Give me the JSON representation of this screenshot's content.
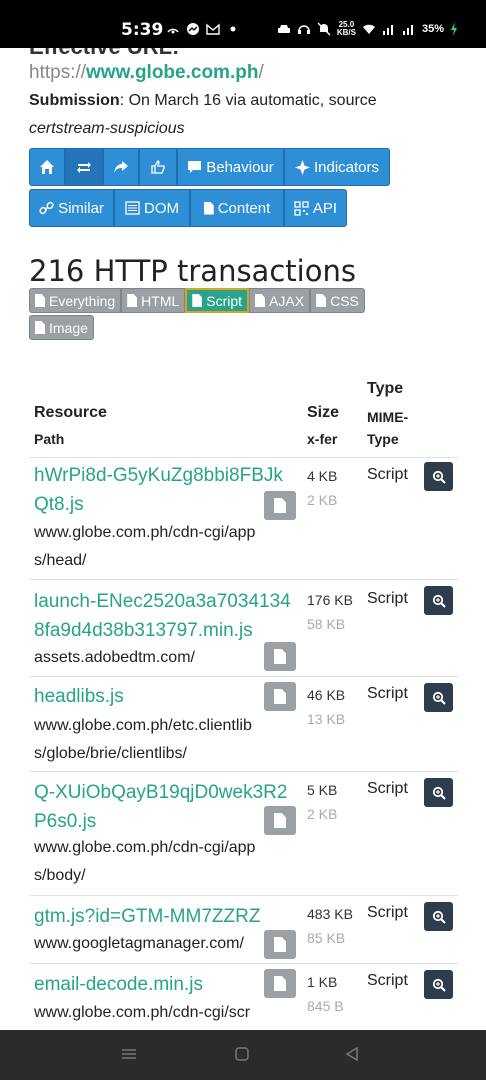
{
  "status_bar": {
    "time": "5:39",
    "net_speed_value": "25.0",
    "net_speed_unit": "KB/S",
    "battery": "35%"
  },
  "page": {
    "heading_cut": "Effective URL:",
    "url_scheme": "https://",
    "url_host": "www.globe.com.ph",
    "url_suffix": "/",
    "submission_label": "Submission",
    "submission_text": ": On March 16 via automatic, source",
    "source_text": "certstream-suspicious",
    "nav_row1": [
      "Behaviour",
      "Indicators"
    ],
    "nav_row2": [
      "Similar",
      "DOM",
      "Content",
      "API"
    ],
    "transactions_title": "216 HTTP transactions",
    "filters": [
      "Everything",
      "HTML",
      "Script",
      "AJAX",
      "CSS",
      "Image"
    ],
    "active_filter": "Script"
  },
  "table": {
    "headers": {
      "type": "Type",
      "resource": "Resource",
      "size": "Size",
      "mime": "MIME-Type",
      "path": "Path",
      "xfer": "x-fer"
    },
    "rows": [
      {
        "name": "hWrPi8d-G5yKuZg8bbi8FBJkQt8.js",
        "path": "www.globe.com.ph/cdn-cgi/apps/head/",
        "size": "4 KB",
        "xfer": "2 KB",
        "type": "Script"
      },
      {
        "name": "launch-ENec2520a3a70341348fa9d4d38b313797.min.js",
        "path": "assets.adobedtm.com/",
        "size": "176 KB",
        "xfer": "58 KB",
        "type": "Script"
      },
      {
        "name": "headlibs.js",
        "path": "www.globe.com.ph/etc.clientlibs/globe/brie/clientlibs/",
        "size": "46 KB",
        "xfer": "13 KB",
        "type": "Script"
      },
      {
        "name": "Q-XUiObQayB19qjD0wek3R2P6s0.js",
        "path": "www.globe.com.ph/cdn-cgi/apps/body/",
        "size": "5 KB",
        "xfer": "2 KB",
        "type": "Script"
      },
      {
        "name": "gtm.js?id=GTM-MM7ZZRZ",
        "path": "www.googletagmanager.com/",
        "size": "483 KB",
        "xfer": "85 KB",
        "type": "Script"
      },
      {
        "name": "email-decode.min.js",
        "path": "www.globe.com.ph/cdn-cgi/scr",
        "size": "1 KB",
        "xfer": "845 B",
        "type": "Script"
      }
    ]
  },
  "colors": {
    "primary_button": "#2f8fd6",
    "link_green": "#26a48a",
    "filter_gray": "#9aa0a4",
    "zoom_button": "#2e3d4c"
  }
}
